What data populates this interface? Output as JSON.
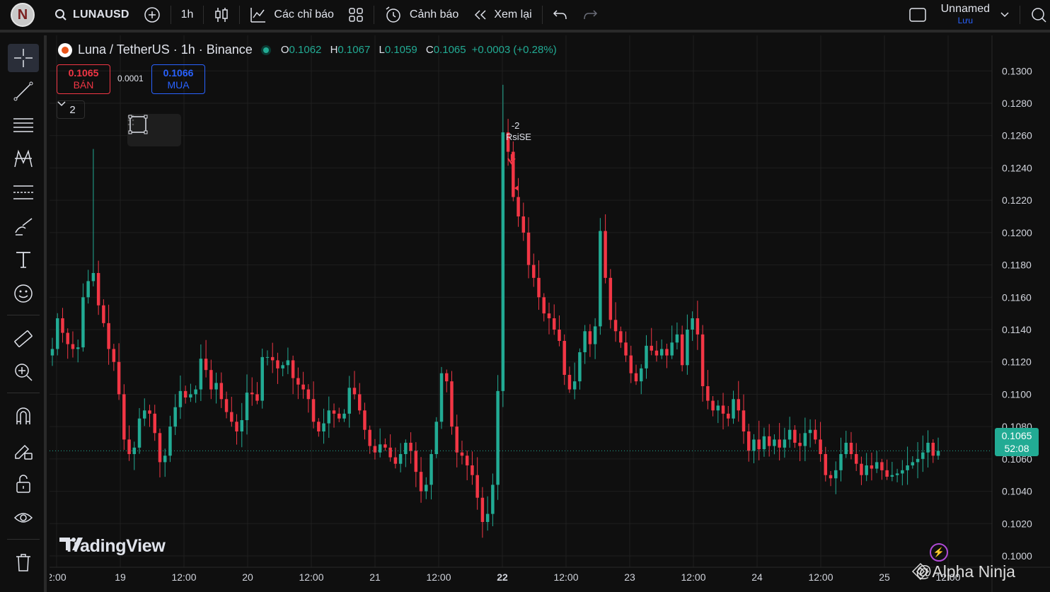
{
  "top_toolbar": {
    "avatar_letter": "N",
    "symbol": "LUNAUSD",
    "interval": "1h",
    "indicators_label": "Các chỉ báo",
    "alerts_label": "Cảnh báo",
    "replay_label": "Xem lại",
    "layout_name": "Unnamed",
    "save_label": "Lưu"
  },
  "left_toolbar": {
    "tools": [
      "crosshair-icon",
      "trend-line-icon",
      "fib-lines-icon",
      "pattern-icon",
      "forecast-icon",
      "brush-icon",
      "text-icon",
      "emoji-icon",
      "ruler-icon",
      "zoom-in-icon",
      "magnet-icon",
      "lock-drawing-icon",
      "unlock-icon",
      "eye-icon",
      "trash-icon"
    ]
  },
  "legend": {
    "title": "Luna / TetherUS · 1h · Binance",
    "o_label": "O",
    "o": "0.1062",
    "h_label": "H",
    "h": "0.1067",
    "l_label": "L",
    "l": "0.1059",
    "c_label": "C",
    "c": "0.1065",
    "change": "+0.0003 (+0.28%)"
  },
  "trade": {
    "sell_price": "0.1065",
    "sell_label": "BÁN",
    "spread": "0.0001",
    "buy_price": "0.1066",
    "buy_label": "MUA"
  },
  "collapse_count": "2",
  "current_price": {
    "price": "0.1065",
    "countdown": "52:08"
  },
  "annotation": {
    "line1": "-2",
    "line2": "RsiSE"
  },
  "brand": {
    "logo_text": "TradingView",
    "watermark": "@Alpha Ninja"
  },
  "colors": {
    "up": "#22ab94",
    "down": "#f23645",
    "background": "#0f0f0f",
    "grid": "#1f1f1f"
  },
  "chart_data": {
    "type": "candlestick",
    "title": "Luna / TetherUS · 1h · Binance",
    "y_ticks": [
      "0.1300",
      "0.1280",
      "0.1260",
      "0.1240",
      "0.1220",
      "0.1200",
      "0.1180",
      "0.1160",
      "0.1140",
      "0.1120",
      "0.1100",
      "0.1080",
      "0.1060",
      "0.1040",
      "0.1020",
      "0.1000"
    ],
    "y_tick_values": [
      0.13,
      0.128,
      0.126,
      0.124,
      0.122,
      0.12,
      0.118,
      0.116,
      0.114,
      0.112,
      0.11,
      0.108,
      0.106,
      0.104,
      0.102,
      0.1
    ],
    "x_ticks": [
      "2:00",
      "19",
      "12:00",
      "20",
      "12:00",
      "21",
      "12:00",
      "22",
      "12:00",
      "23",
      "12:00",
      "24",
      "12:00",
      "25",
      "12:00"
    ],
    "x_tick_bold_index": 7,
    "ylim": [
      0.0993,
      0.1322
    ],
    "close_path_description": "hourly closes",
    "closes": [
      0.1128,
      0.1147,
      0.1138,
      0.1131,
      0.1128,
      0.1129,
      0.116,
      0.117,
      0.1175,
      0.1155,
      0.1144,
      0.1128,
      0.112,
      0.11,
      0.1072,
      0.1063,
      0.1067,
      0.1085,
      0.109,
      0.1088,
      0.1076,
      0.1058,
      0.1062,
      0.108,
      0.1092,
      0.1102,
      0.1098,
      0.11,
      0.1103,
      0.1122,
      0.1115,
      0.1103,
      0.1107,
      0.1097,
      0.1089,
      0.1083,
      0.1077,
      0.1084,
      0.1101,
      0.11,
      0.1096,
      0.1123,
      0.1123,
      0.1121,
      0.1116,
      0.1118,
      0.1121,
      0.111,
      0.1106,
      0.1103,
      0.1097,
      0.1083,
      0.1077,
      0.1082,
      0.109,
      0.1088,
      0.1085,
      0.1088,
      0.1104,
      0.11,
      0.109,
      0.1078,
      0.1068,
      0.1064,
      0.1069,
      0.1067,
      0.1061,
      0.1057,
      0.1063,
      0.107,
      0.1065,
      0.1052,
      0.104,
      0.1044,
      0.1063,
      0.1083,
      0.1113,
      0.1108,
      0.108,
      0.1064,
      0.1062,
      0.1056,
      0.105,
      0.1036,
      0.1021,
      0.1026,
      0.1044,
      0.1102,
      0.1262,
      0.125,
      0.1222,
      0.121,
      0.12,
      0.118,
      0.1172,
      0.116,
      0.115,
      0.1147,
      0.114,
      0.1133,
      0.1112,
      0.1103,
      0.1108,
      0.1126,
      0.1139,
      0.1131,
      0.1142,
      0.1201,
      0.1172,
      0.1146,
      0.1139,
      0.1132,
      0.1124,
      0.1113,
      0.1108,
      0.1116,
      0.113,
      0.1127,
      0.1124,
      0.1128,
      0.1124,
      0.1132,
      0.1137,
      0.1118,
      0.114,
      0.1147,
      0.1137,
      0.1105,
      0.1096,
      0.109,
      0.1093,
      0.1088,
      0.1085,
      0.1097,
      0.109,
      0.1077,
      0.1065,
      0.1072,
      0.1066,
      0.1074,
      0.1068,
      0.1072,
      0.1067,
      0.1072,
      0.1078,
      0.107,
      0.1068,
      0.1076,
      0.1078,
      0.1072,
      0.1063,
      0.105,
      0.1048,
      0.1053,
      0.1063,
      0.107,
      0.1063,
      0.1057,
      0.105,
      0.1056,
      0.1054,
      0.1058,
      0.1053,
      0.1049,
      0.105,
      0.1051,
      0.1053,
      0.1056,
      0.1058,
      0.106,
      0.1064,
      0.107,
      0.1062,
      0.1065
    ],
    "series_colors": {
      "up": "#22ab94",
      "down": "#f23645"
    }
  }
}
